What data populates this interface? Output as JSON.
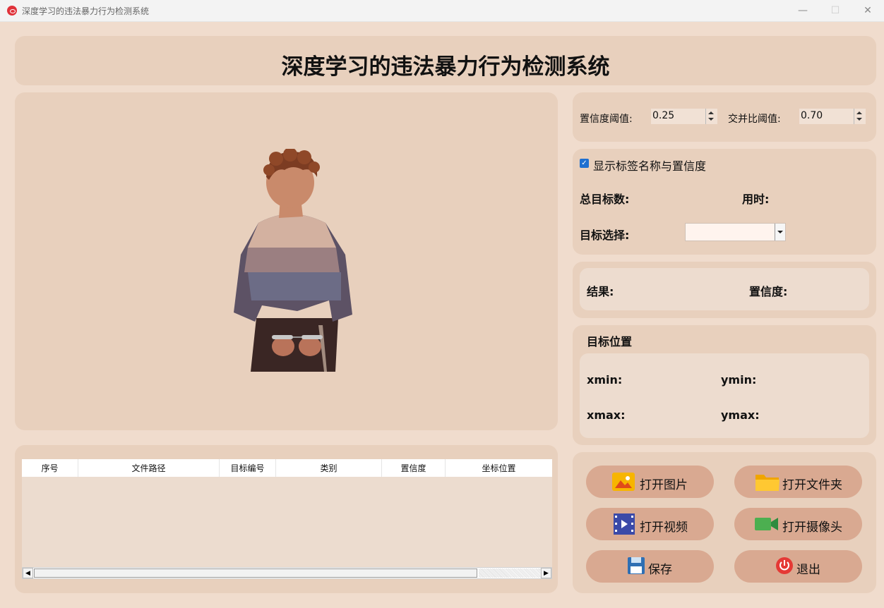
{
  "window": {
    "title": "深度学习的违法暴力行为检测系统",
    "min": "—",
    "max": "☐",
    "close": "✕"
  },
  "header": {
    "title": "深度学习的违法暴力行为检测系统"
  },
  "params": {
    "conf_label": "置信度阈值:",
    "conf_value": "0.25",
    "iou_label": "交并比阈值:",
    "iou_value": "0.70"
  },
  "options": {
    "show_labels": "显示标签名称与置信度",
    "total_label": "总目标数:",
    "time_label": "用时:",
    "target_select_label": "目标选择:",
    "target_select_value": ""
  },
  "result": {
    "result_label": "结果:",
    "conf_label": "置信度:"
  },
  "position": {
    "title": "目标位置",
    "xmin": "xmin:",
    "ymin": "ymin:",
    "xmax": "xmax:",
    "ymax": "ymax:"
  },
  "table": {
    "columns": [
      "序号",
      "文件路径",
      "目标编号",
      "类别",
      "置信度",
      "坐标位置"
    ]
  },
  "buttons": {
    "open_image": "打开图片",
    "open_folder": "打开文件夹",
    "open_video": "打开视频",
    "open_camera": "打开摄像头",
    "save": "保存",
    "exit": "退出"
  },
  "colors": {
    "bg": "#f0dccd",
    "panel": "#e8d0bd",
    "button": "#d9a991",
    "accent": "#1e6fd1"
  }
}
